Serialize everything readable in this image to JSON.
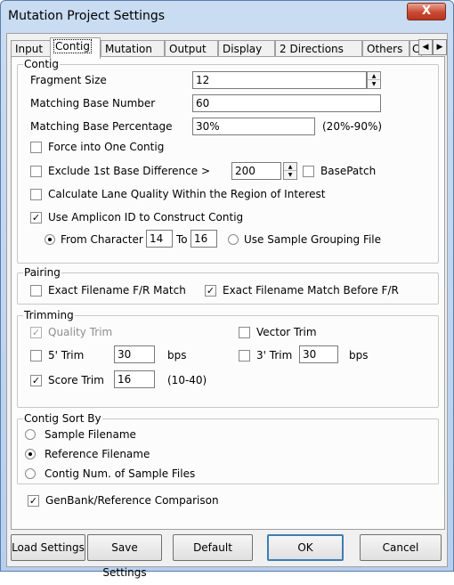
{
  "window": {
    "title": "Mutation Project Settings",
    "close_label": "X"
  },
  "tabs": [
    "Input",
    "Contig",
    "Mutation",
    "Output",
    "Display",
    "2 Directions",
    "Others",
    "C"
  ],
  "contig": {
    "group_title": "Contig",
    "fragment_size_label": "Fragment Size",
    "fragment_size_value": "12",
    "matching_base_number_label": "Matching Base Number",
    "matching_base_number_value": "60",
    "matching_base_pct_label": "Matching Base Percentage",
    "matching_base_pct_value": "30%",
    "matching_base_pct_range": "(20%-90%)",
    "force_one_contig_label": "Force into One Contig",
    "force_one_contig_checked": false,
    "exclude_first_base_label": "Exclude 1st Base Difference >",
    "exclude_first_base_checked": false,
    "exclude_first_base_value": "200",
    "base_patch_label": "BasePatch",
    "base_patch_checked": false,
    "lane_quality_label": "Calculate Lane Quality Within the Region of  Interest",
    "lane_quality_checked": false,
    "amplicon_label": "Use Amplicon ID to Construct Contig",
    "amplicon_checked": true,
    "from_character_label": "From Character",
    "from_character_selected": true,
    "from_value": "14",
    "to_label": "To",
    "to_value": "16",
    "sample_grouping_label": "Use Sample Grouping File",
    "sample_grouping_selected": false
  },
  "pairing": {
    "group_title": "Pairing",
    "exact_fr_label": "Exact Filename F/R Match",
    "exact_fr_checked": false,
    "exact_before_fr_label": "Exact Filename Match Before F/R",
    "exact_before_fr_checked": true
  },
  "trimming": {
    "group_title": "Trimming",
    "quality_trim_label": "Quality Trim",
    "quality_trim_checked": true,
    "vector_trim_label": "Vector Trim",
    "vector_trim_checked": false,
    "five_trim_label": "5' Trim",
    "five_trim_checked": false,
    "five_trim_value": "30",
    "five_trim_unit": "bps",
    "three_trim_label": "3' Trim",
    "three_trim_checked": false,
    "three_trim_value": "30",
    "three_trim_unit": "bps",
    "score_trim_label": "Score Trim",
    "score_trim_checked": true,
    "score_trim_value": "16",
    "score_trim_range": "(10-40)"
  },
  "sort": {
    "group_title": "Contig Sort By",
    "options": [
      "Sample Filename",
      "Reference Filename",
      "Contig Num. of Sample Files"
    ],
    "selected_index": 1
  },
  "genbank": {
    "label": "GenBank/Reference Comparison",
    "checked": true
  },
  "buttons": {
    "load": "Load Settings",
    "save": "Save Settings",
    "default": "Default",
    "ok": "OK",
    "cancel": "Cancel"
  }
}
